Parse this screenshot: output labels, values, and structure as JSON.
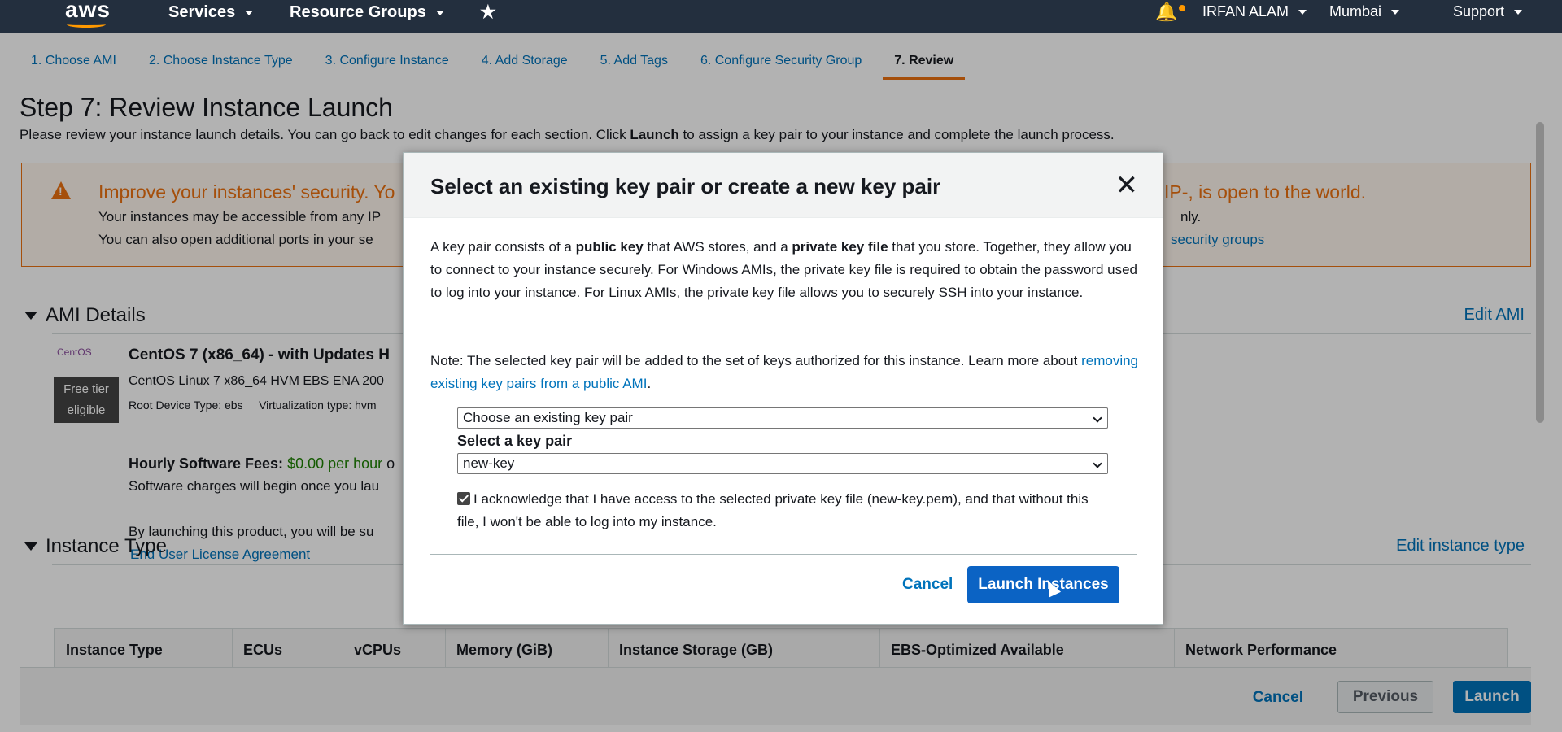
{
  "topnav": {
    "logo": "aws",
    "services": "Services",
    "resource_groups": "Resource Groups",
    "user": "IRFAN ALAM",
    "region": "Mumbai",
    "support": "Support"
  },
  "wizard": {
    "tabs": [
      {
        "label": "1. Choose AMI"
      },
      {
        "label": "2. Choose Instance Type"
      },
      {
        "label": "3. Configure Instance"
      },
      {
        "label": "4. Add Storage"
      },
      {
        "label": "5. Add Tags"
      },
      {
        "label": "6. Configure Security Group"
      },
      {
        "label": "7. Review"
      }
    ],
    "title": "Step 7: Review Instance Launch",
    "desc_a": "Please review your instance launch details. You can go back to edit changes for each section. Click ",
    "desc_bold": "Launch",
    "desc_b": " to assign a key pair to your instance and complete the launch process."
  },
  "warning": {
    "title_a": "Improve your instances' security. Yo",
    "title_b": "IP-, is open to the world.",
    "line1_a": "Your instances may be accessible from any IP",
    "line1_b": "nly.",
    "line2_a": "You can also open additional ports in your se",
    "link": "security groups"
  },
  "ami": {
    "section": "AMI Details",
    "edit": "Edit AMI",
    "logo": "CentOS",
    "badge": "Free tier eligible",
    "name": "CentOS 7 (x86_64) - with Updates H",
    "desc": "CentOS Linux 7 x86_64 HVM EBS ENA 200",
    "root_device": "Root Device Type: ebs",
    "virt": "Virtualization type: hvm",
    "fees_label": "Hourly Software Fees:",
    "fees_value": "$0.00 per hour",
    "fees_tail": "o",
    "charges": "Software charges will begin once you lau",
    "launching": "By launching this product, you will be su",
    "eula": "End User License Agreement"
  },
  "instance_type": {
    "section": "Instance Type",
    "edit": "Edit instance type",
    "columns": [
      "Instance Type",
      "ECUs",
      "vCPUs",
      "Memory (GiB)",
      "Instance Storage (GB)",
      "EBS-Optimized Available",
      "Network Performance"
    ]
  },
  "footer": {
    "cancel": "Cancel",
    "previous": "Previous",
    "launch": "Launch"
  },
  "modal": {
    "title": "Select an existing key pair or create a new key pair",
    "p1_a": "A key pair consists of a ",
    "p1_b": "public key",
    "p1_c": " that AWS stores, and a ",
    "p1_d": "private key file",
    "p1_e": " that you store. Together, they allow you to connect to your instance securely. For Windows AMIs, the private key file is required to obtain the password used to log into your instance. For Linux AMIs, the private key file allows you to securely SSH into your instance.",
    "note_a": "Note: The selected key pair will be added to the set of keys authorized for this instance. Learn more about ",
    "note_link": "removing existing key pairs from a public AMI",
    "note_b": ".",
    "select_mode": "Choose an existing key pair",
    "key_label": "Select a key pair",
    "key_value": "new-key",
    "ack": "I acknowledge that I have access to the selected private key file (new-key.pem), and that without this file, I won't be able to log into my instance.",
    "cancel": "Cancel",
    "launch": "Launch Instances"
  }
}
